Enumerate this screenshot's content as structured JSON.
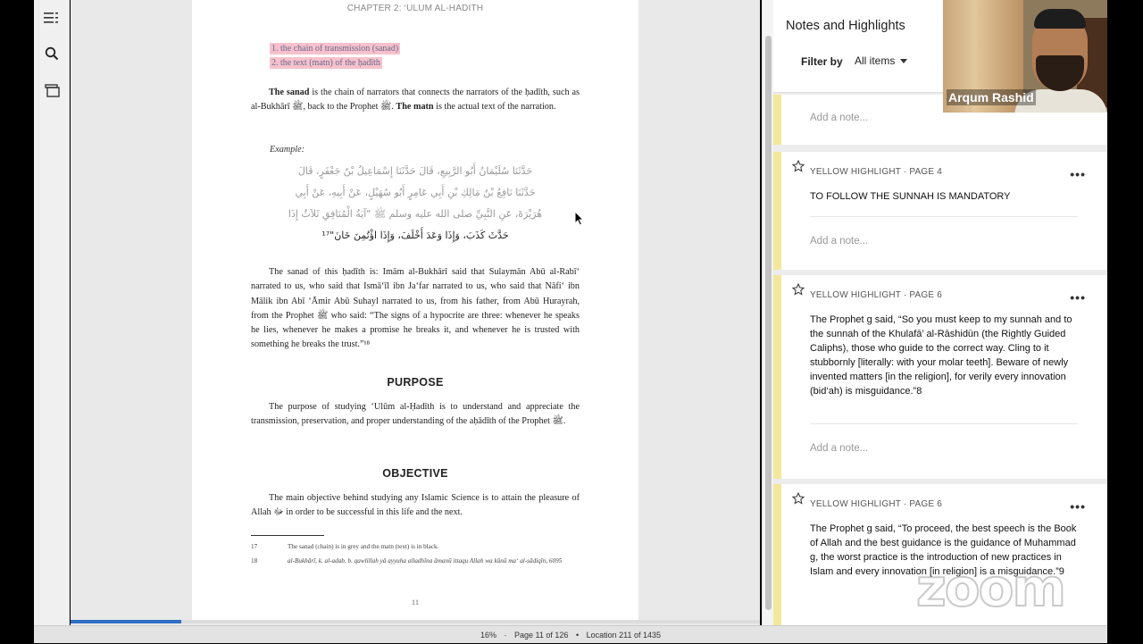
{
  "toolbar": {
    "icons": [
      "toc-icon",
      "search-icon",
      "flashcards-icon"
    ]
  },
  "book": {
    "running_head": "CHAPTER 2: ‘ULUM AL-HADITH",
    "highlights": [
      "1.    the chain of transmission (sanad)",
      "2.    the text (matn) of the ḥadīth"
    ],
    "para1_parts": {
      "b1": "The sanad",
      "t1": " is the chain of narrators that connects the narrators of the ḥadīth, such as al-Bukhārī ﷺ, back to the Prophet ﷺ. ",
      "b2": "The matn",
      "t2": " is the actual text of the narration."
    },
    "example_label": "Example:",
    "arabic_lines": [
      "حَدَّثَنَا سُلَيْمَانُ أَبُو الرَّبِيعِ، قَالَ حَدَّثَنَا إِسْمَاعِيلُ بْنُ جَعْفَرٍ، قَالَ",
      "حَدَّثَنَا نَافِعُ بْنُ مَالِكِ بْنِ أَبِي عَامِرٍ أَبُو سُهَيْلٍ، عَنْ أَبِيهِ، عَنْ أَبِي",
      "هُرَيْرَةَ، عَنِ النَّبِيِّ صلى الله عليه وسلم ﷺ \"آيَةُ الْمُنَافِقِ ثَلاَثٌ إِذَا",
      "حَدَّثَ كَذَبَ، وَإِذَا وَعَدَ أَخْلَفَ، وَإِذَا اؤْتُمِنَ خَانَ\"¹⁷"
    ],
    "para2": "The sanad of this ḥadīth is: Imām al-Bukhārī said that Sulaymān Abū al-Rabī‘ narrated to us, who said that Ismā‘īl ibn Ja‘far narrated to us, who said that Nāfi‘ ibn Mālik ibn Abī ‘Āmir Abū Suhayl narrated to us, from his father, from Abū Hurayrah, from the Prophet ﷺ who said: “The signs of a hypocrite are three: whenever he speaks he lies, whenever he makes a promise he breaks it, and whenever he is trusted with something he breaks the trust.”¹⁸",
    "heading_purpose": "PURPOSE",
    "para3": "The purpose of studying ‘Ulūm al-Ḥadīth is to understand and appreciate the transmission, preservation, and proper understanding of the aḥādīth of the Prophet ﷺ.",
    "heading_objective": "OBJECTIVE",
    "para4": "The main objective behind studying any Islamic Science is to attain the pleasure of Allah ﷻ in order to be successful in this life and the next.",
    "footnotes": [
      {
        "num": "17",
        "text": "The sanad (chain) is in grey and the matn (text) is in black."
      },
      {
        "num": "18",
        "text": "al-Bukhārī, k. al-adab, b. qawlillah yā ayyuha alladhīna āmanū ittaqu Allah wa kūnū ma‘ al-ṣādiqīn, 6095"
      }
    ],
    "page_number": "11"
  },
  "progress": {
    "percent_value": 0.16
  },
  "status": {
    "percent": "16%",
    "page": "Page 11 of 126",
    "location": "Location 211 of 1435"
  },
  "notes": {
    "title": "Notes and Highlights",
    "filter_label": "Filter by",
    "filter_value": "All items",
    "add_note_placeholder": "Add a note...",
    "cards": [
      {
        "kind": "YELLOW HIGHLIGHT · PAGE 4",
        "text": "TO FOLLOW THE SUNNAH IS MANDATORY"
      },
      {
        "kind": "YELLOW HIGHLIGHT · PAGE 6",
        "text": "The Prophet g said, “So you must keep to my sunnah and to the sunnah of the Khulafā’ al-Rāshidūn (the Rightly Guided Caliphs), those who guide to the correct way. Cling to it stubbornly [literally: with your molar teeth]. Beware of newly invented matters [in the religion], for verily every innovation (bid‘ah) is misguidance.”8"
      },
      {
        "kind": "YELLOW HIGHLIGHT · PAGE 6",
        "text": "The Prophet g said, “To proceed, the best speech is the Book of Allah and the best guidance is the guidance of Muhammad g, the worst practice is the introduction of new practices in Islam and every innovation [in religion] is a misguidance.”9"
      }
    ],
    "more_glyph": "•••"
  },
  "video": {
    "participant_name": "Arqum Rashid"
  },
  "watermark": "zoom",
  "colors": {
    "highlight_pink": "#f6c1cd",
    "highlight_yellow": "#f3e79b",
    "progress_blue": "#2e6fc2"
  }
}
